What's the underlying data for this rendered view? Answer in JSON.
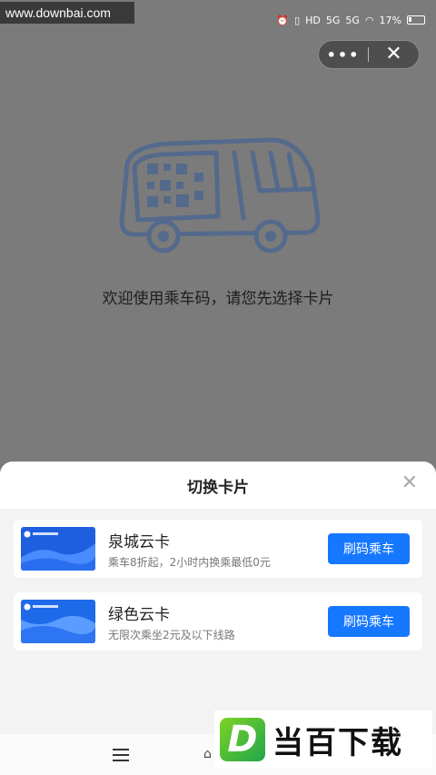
{
  "watermark": {
    "url": "www.downbai.com",
    "brand": "当百下载",
    "badge_letter": "D"
  },
  "status_bar": {
    "hd": "HD",
    "net1": "5G",
    "net2": "5G",
    "battery": "17%"
  },
  "capsule": {
    "more": "•••",
    "close": "✕"
  },
  "main": {
    "welcome": "欢迎使用乘车码，请您先选择卡片"
  },
  "sheet": {
    "title": "切换卡片",
    "close": "✕",
    "cards": [
      {
        "name": "泉城云卡",
        "desc": "乘车8折起，2小时内换乘最低0元",
        "button": "刷码乘车",
        "color": "#1e5fe0"
      },
      {
        "name": "绿色云卡",
        "desc": "无限次乘坐2元及以下线路",
        "button": "刷码乘车",
        "color": "#1e6ae8"
      }
    ]
  },
  "colors": {
    "accent": "#1677ff",
    "overlay": "#7b7b7b"
  }
}
